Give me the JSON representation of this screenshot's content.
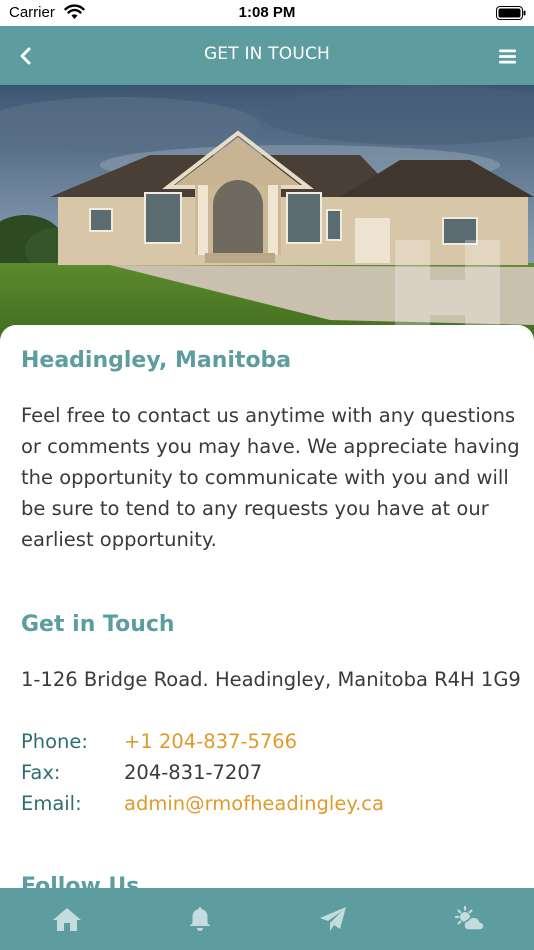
{
  "status_bar": {
    "carrier": "Carrier",
    "time": "1:08 PM"
  },
  "nav": {
    "title": "GET IN TOUCH",
    "back_icon": "chevron-left-icon",
    "menu_icon": "hamburger-menu-icon"
  },
  "hero_image": {
    "description_icon": "house-photo"
  },
  "content": {
    "location_heading": "Headingley, Manitoba",
    "intro": "Feel free to contact us anytime with any questions or comments you may have. We appreciate having the opportunity to communicate with you and will be sure to tend to any requests you have at our earliest opportunity.",
    "contact_heading": "Get in Touch",
    "address": "1-126 Bridge Road. Headingley, Manitoba R4H 1G9",
    "contacts": [
      {
        "label": "Phone:",
        "value": "+1 204-837-5766"
      },
      {
        "label": "Fax:",
        "value": "204-831-7207"
      },
      {
        "label": "Email:",
        "value": "admin@rmofheadingley.ca"
      }
    ],
    "follow_heading": "Follow Us"
  },
  "tab_bar": {
    "tabs": [
      {
        "name": "home",
        "icon": "home-icon"
      },
      {
        "name": "notifications",
        "icon": "bell-icon"
      },
      {
        "name": "send",
        "icon": "paper-plane-icon"
      },
      {
        "name": "weather",
        "icon": "weather-icon"
      }
    ]
  },
  "colors": {
    "brand": "#5d9da0",
    "link": "#e09a2b",
    "text": "#3a3a3a",
    "label": "#2f6e70"
  }
}
